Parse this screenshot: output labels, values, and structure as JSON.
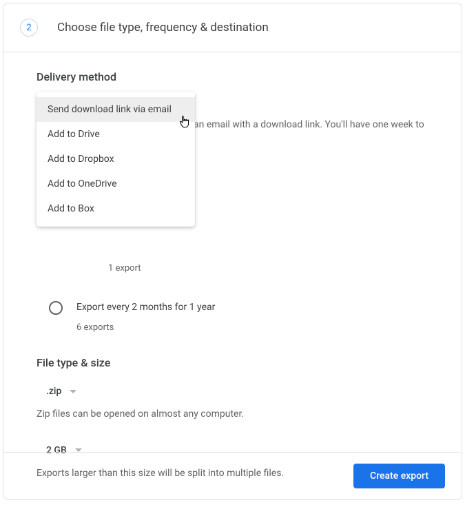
{
  "step": {
    "number": "2",
    "title": "Choose file type, frequency & destination"
  },
  "delivery": {
    "section_title": "Delivery method",
    "partial_description": "an email with a download link. You'll have one week to",
    "options": [
      "Send download link via email",
      "Add to Drive",
      "Add to Dropbox",
      "Add to OneDrive",
      "Add to Box"
    ]
  },
  "frequency": {
    "option1": {
      "sub": "1 export"
    },
    "option2": {
      "main": "Export every 2 months for 1 year",
      "sub": "6 exports"
    }
  },
  "file": {
    "section_title": "File type & size",
    "type_value": ".zip",
    "type_helper": "Zip files can be opened on almost any computer.",
    "size_value": "2 GB",
    "size_helper": "Exports larger than this size will be split into multiple files."
  },
  "footer": {
    "create_label": "Create export"
  }
}
